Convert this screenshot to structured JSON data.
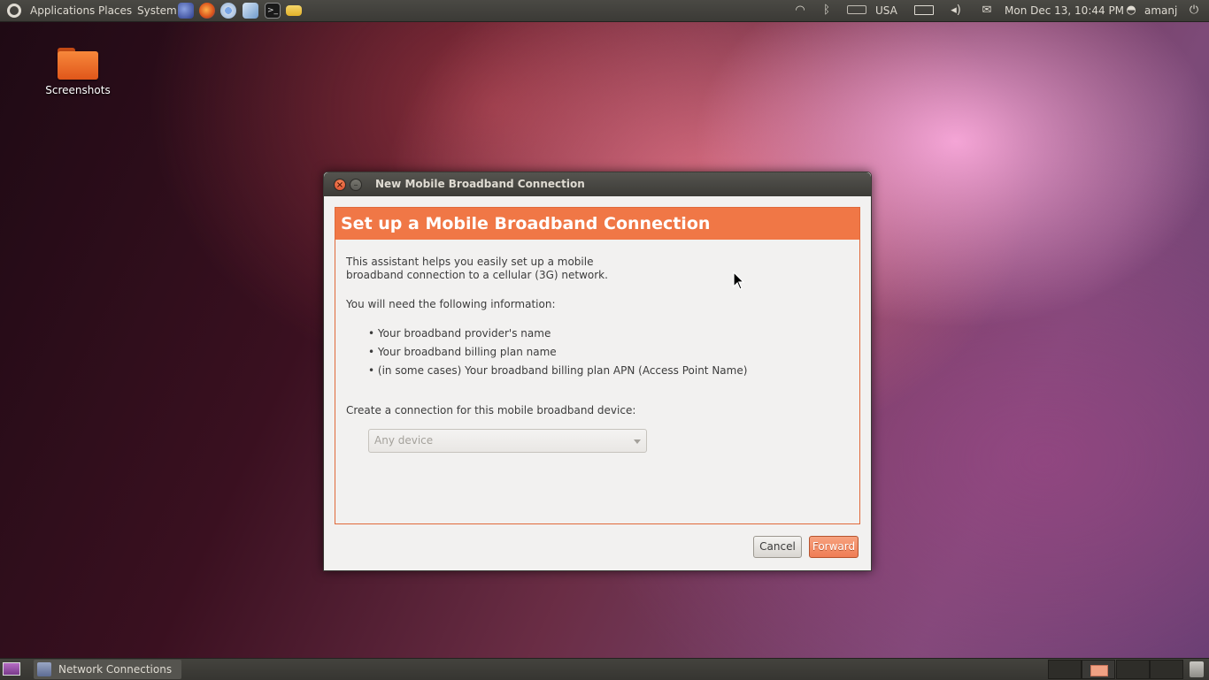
{
  "top_panel": {
    "menus": [
      "Applications",
      "Places",
      "System"
    ],
    "launchers": [
      "eclipse-icon",
      "firefox-icon",
      "chromium-icon",
      "package-icon",
      "terminal-icon",
      "folder-icon"
    ],
    "keyboard_layout": "USA",
    "datetime": "Mon Dec 13, 10:44 PM",
    "user": "amanj",
    "indicators": [
      "wifi-icon",
      "bluetooth-icon",
      "keyboard-icon",
      "battery-icon",
      "volume-icon",
      "mail-icon",
      "user-icon",
      "power-icon"
    ]
  },
  "desktop": {
    "icons": [
      {
        "label": "Screenshots",
        "icon": "folder-icon"
      }
    ]
  },
  "dialog": {
    "title": "New Mobile Broadband Connection",
    "header": "Set up a Mobile Broadband Connection",
    "intro_line1": "This assistant helps you easily set up a mobile",
    "intro_line2": "broadband connection to a cellular (3G) network.",
    "need_info": "You will need the following information:",
    "bullets": [
      "• Your broadband provider's name",
      "• Your broadband billing plan name",
      "• (in some cases) Your broadband billing plan APN (Access Point Name)"
    ],
    "device_label": "Create a connection for this mobile broadband device:",
    "device_select": {
      "selected": "Any device"
    },
    "buttons": {
      "cancel": "Cancel",
      "forward": "Forward"
    }
  },
  "bottom_panel": {
    "task": {
      "label": "Network Connections",
      "icon": "network-connections-icon"
    },
    "workspaces": 4
  },
  "colors": {
    "accent": "#f07746",
    "panel": "#3c3b37",
    "forward_button": "#ef7d55"
  }
}
